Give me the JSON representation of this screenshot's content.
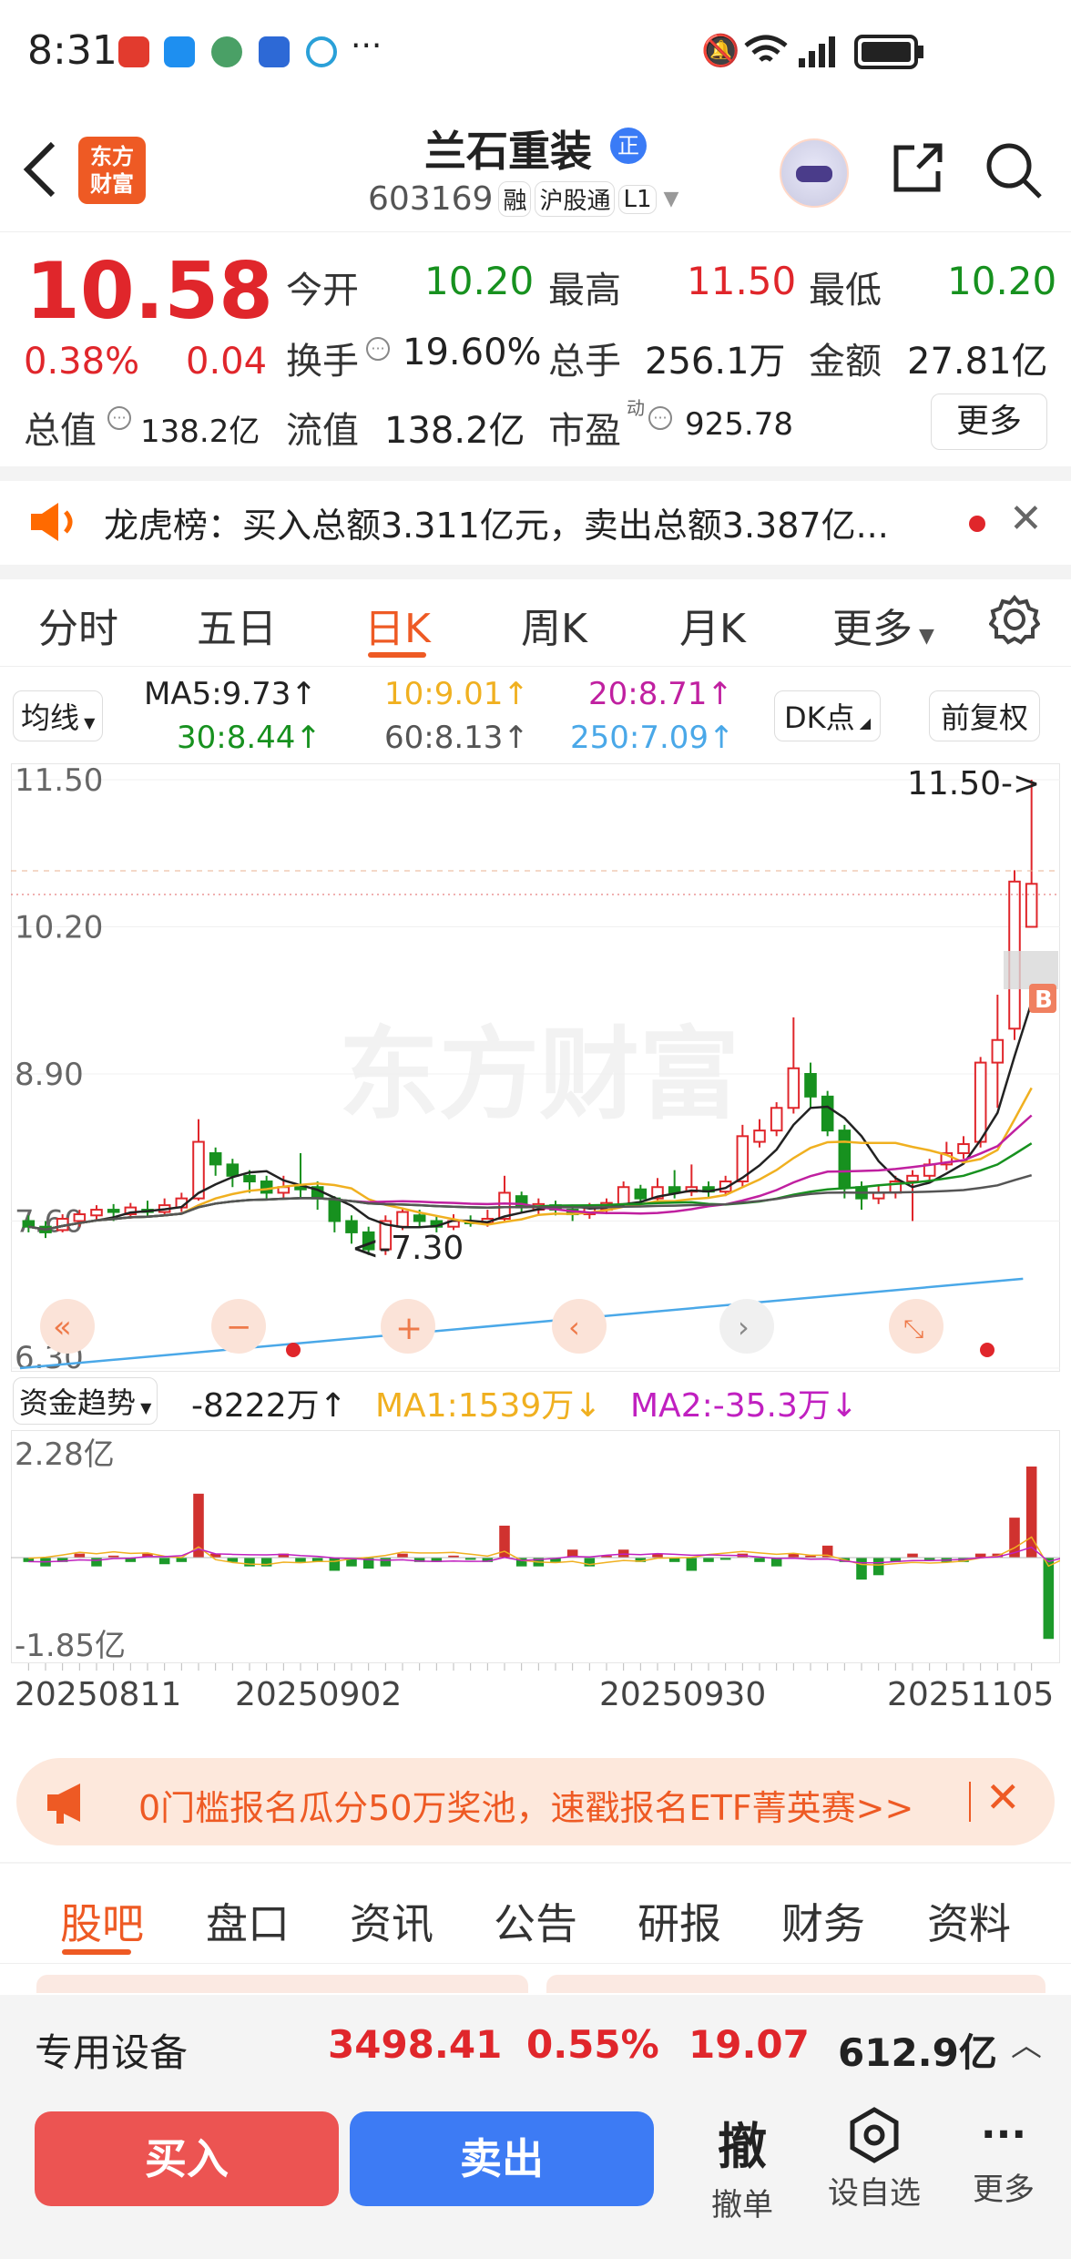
{
  "status": {
    "time": "8:31"
  },
  "header": {
    "title": "兰石重装",
    "cert_badge": "正",
    "code": "603169",
    "tags": [
      "融",
      "沪股通",
      "L1"
    ],
    "logo_line1": "东方",
    "logo_line2": "财富"
  },
  "quote": {
    "price": "10.58",
    "change_pct": "0.38%",
    "change_amt": "0.04",
    "open_label": "今开",
    "open": "10.20",
    "high_label": "最高",
    "high": "11.50",
    "low_label": "最低",
    "low": "10.20",
    "turnover_label": "换手",
    "turnover": "19.60%",
    "volume_label": "总手",
    "volume": "256.1万",
    "amount_label": "金额",
    "amount": "27.81亿",
    "mcap_label": "总值",
    "mcap": "138.2亿",
    "float_label": "流值",
    "float_cap": "138.2亿",
    "pe_label": "市盈",
    "pe_sup": "动",
    "pe": "925.78",
    "more": "更多"
  },
  "notice": {
    "text": "龙虎榜：买入总额3.311亿元，卖出总额3.387亿..."
  },
  "chart_tabs": [
    "分时",
    "五日",
    "日K",
    "周K",
    "月K",
    "更多"
  ],
  "active_tab": "日K",
  "ma_legend": {
    "btn": "均线",
    "ma5": "MA5:9.73↑",
    "ma10": "10:9.01↑",
    "ma20": "20:8.71↑",
    "ma30": "30:8.44↑",
    "ma60": "60:8.13↑",
    "ma250": "250:7.09↑",
    "dk": "DK点",
    "fq": "前复权"
  },
  "kline": {
    "y_labels": [
      "11.50",
      "10.20",
      "8.90",
      "7.60",
      "6.30"
    ],
    "high_note": "11.50->",
    "low_note": "<-7.30",
    "b_marker": "B",
    "watermark": "东方财富"
  },
  "fund": {
    "btn": "资金趋势",
    "value": "-8222万↑",
    "ma1": "MA1:1539万↓",
    "ma2": "MA2:-35.3万↓",
    "y_top": "2.28亿",
    "y_bottom": "-1.85亿"
  },
  "dates": [
    "20250811",
    "20250902",
    "20250930",
    "20251105"
  ],
  "banner": {
    "text": "0门槛报名瓜分50万奖池，速戳报名ETF菁英赛>>"
  },
  "bottom_tabs": [
    "股吧",
    "盘口",
    "资讯",
    "公告",
    "研报",
    "财务",
    "资料"
  ],
  "sector": {
    "name": "专用设备",
    "index": "3498.41",
    "pct": "0.55%",
    "change": "19.07",
    "amount": "612.9亿"
  },
  "actions": {
    "buy": "买入",
    "sell": "卖出",
    "cancel_icon": "撤",
    "cancel": "撤单",
    "watch": "设自选",
    "more": "更多"
  },
  "chart_data": {
    "type": "candlestick",
    "ylim": [
      6.3,
      11.5
    ],
    "x_ticks": [
      "20250811",
      "20250902",
      "20250930",
      "20251105"
    ],
    "candles": [
      [
        7.6,
        7.55,
        7.65,
        7.5
      ],
      [
        7.55,
        7.5,
        7.6,
        7.45
      ],
      [
        7.52,
        7.62,
        7.66,
        7.5
      ],
      [
        7.6,
        7.66,
        7.7,
        7.55
      ],
      [
        7.65,
        7.7,
        7.74,
        7.6
      ],
      [
        7.7,
        7.68,
        7.75,
        7.6
      ],
      [
        7.66,
        7.72,
        7.76,
        7.62
      ],
      [
        7.7,
        7.68,
        7.78,
        7.64
      ],
      [
        7.68,
        7.74,
        7.8,
        7.65
      ],
      [
        7.72,
        7.8,
        7.85,
        7.68
      ],
      [
        7.8,
        8.3,
        8.5,
        7.78
      ],
      [
        8.2,
        8.1,
        8.25,
        8.0
      ],
      [
        8.1,
        8.0,
        8.15,
        7.9
      ],
      [
        8.0,
        7.95,
        8.05,
        7.85
      ],
      [
        7.95,
        7.85,
        8.0,
        7.8
      ],
      [
        7.85,
        7.9,
        8.0,
        7.8
      ],
      [
        7.9,
        7.88,
        8.2,
        7.8
      ],
      [
        7.9,
        7.8,
        7.95,
        7.7
      ],
      [
        7.8,
        7.6,
        7.82,
        7.5
      ],
      [
        7.6,
        7.5,
        7.65,
        7.4
      ],
      [
        7.5,
        7.35,
        7.55,
        7.3
      ],
      [
        7.35,
        7.6,
        7.65,
        7.3
      ],
      [
        7.55,
        7.68,
        7.72,
        7.52
      ],
      [
        7.65,
        7.6,
        7.7,
        7.55
      ],
      [
        7.6,
        7.55,
        7.65,
        7.5
      ],
      [
        7.55,
        7.6,
        7.66,
        7.52
      ],
      [
        7.6,
        7.58,
        7.65,
        7.55
      ],
      [
        7.58,
        7.62,
        7.7,
        7.55
      ],
      [
        7.62,
        7.85,
        8.0,
        7.6
      ],
      [
        7.82,
        7.72,
        7.86,
        7.68
      ],
      [
        7.7,
        7.75,
        7.8,
        7.66
      ],
      [
        7.74,
        7.7,
        7.78,
        7.65
      ],
      [
        7.7,
        7.66,
        7.74,
        7.6
      ],
      [
        7.66,
        7.72,
        7.76,
        7.62
      ],
      [
        7.7,
        7.76,
        7.8,
        7.66
      ],
      [
        7.75,
        7.9,
        7.95,
        7.72
      ],
      [
        7.88,
        7.8,
        7.92,
        7.76
      ],
      [
        7.8,
        7.9,
        7.98,
        7.78
      ],
      [
        7.9,
        7.85,
        8.05,
        7.8
      ],
      [
        7.86,
        7.9,
        8.1,
        7.82
      ],
      [
        7.9,
        7.86,
        7.95,
        7.8
      ],
      [
        7.86,
        7.95,
        8.0,
        7.82
      ],
      [
        7.95,
        8.35,
        8.45,
        7.9
      ],
      [
        8.3,
        8.4,
        8.5,
        8.25
      ],
      [
        8.4,
        8.6,
        8.65,
        8.35
      ],
      [
        8.6,
        8.95,
        9.4,
        8.55
      ],
      [
        8.9,
        8.7,
        9.0,
        8.6
      ],
      [
        8.7,
        8.4,
        8.75,
        8.35
      ],
      [
        8.4,
        7.9,
        8.45,
        7.8
      ],
      [
        7.9,
        7.8,
        7.95,
        7.7
      ],
      [
        7.8,
        7.85,
        7.92,
        7.75
      ],
      [
        7.85,
        7.95,
        8.0,
        7.8
      ],
      [
        7.95,
        8.0,
        8.05,
        7.6
      ],
      [
        8.0,
        8.1,
        8.15,
        7.95
      ],
      [
        8.1,
        8.2,
        8.3,
        8.05
      ],
      [
        8.2,
        8.28,
        8.35,
        8.15
      ],
      [
        8.3,
        9.0,
        9.05,
        8.25
      ],
      [
        9.0,
        9.2,
        9.6,
        8.6
      ],
      [
        9.3,
        10.6,
        10.7,
        9.2
      ],
      [
        10.2,
        10.58,
        11.5,
        10.2
      ]
    ]
  }
}
